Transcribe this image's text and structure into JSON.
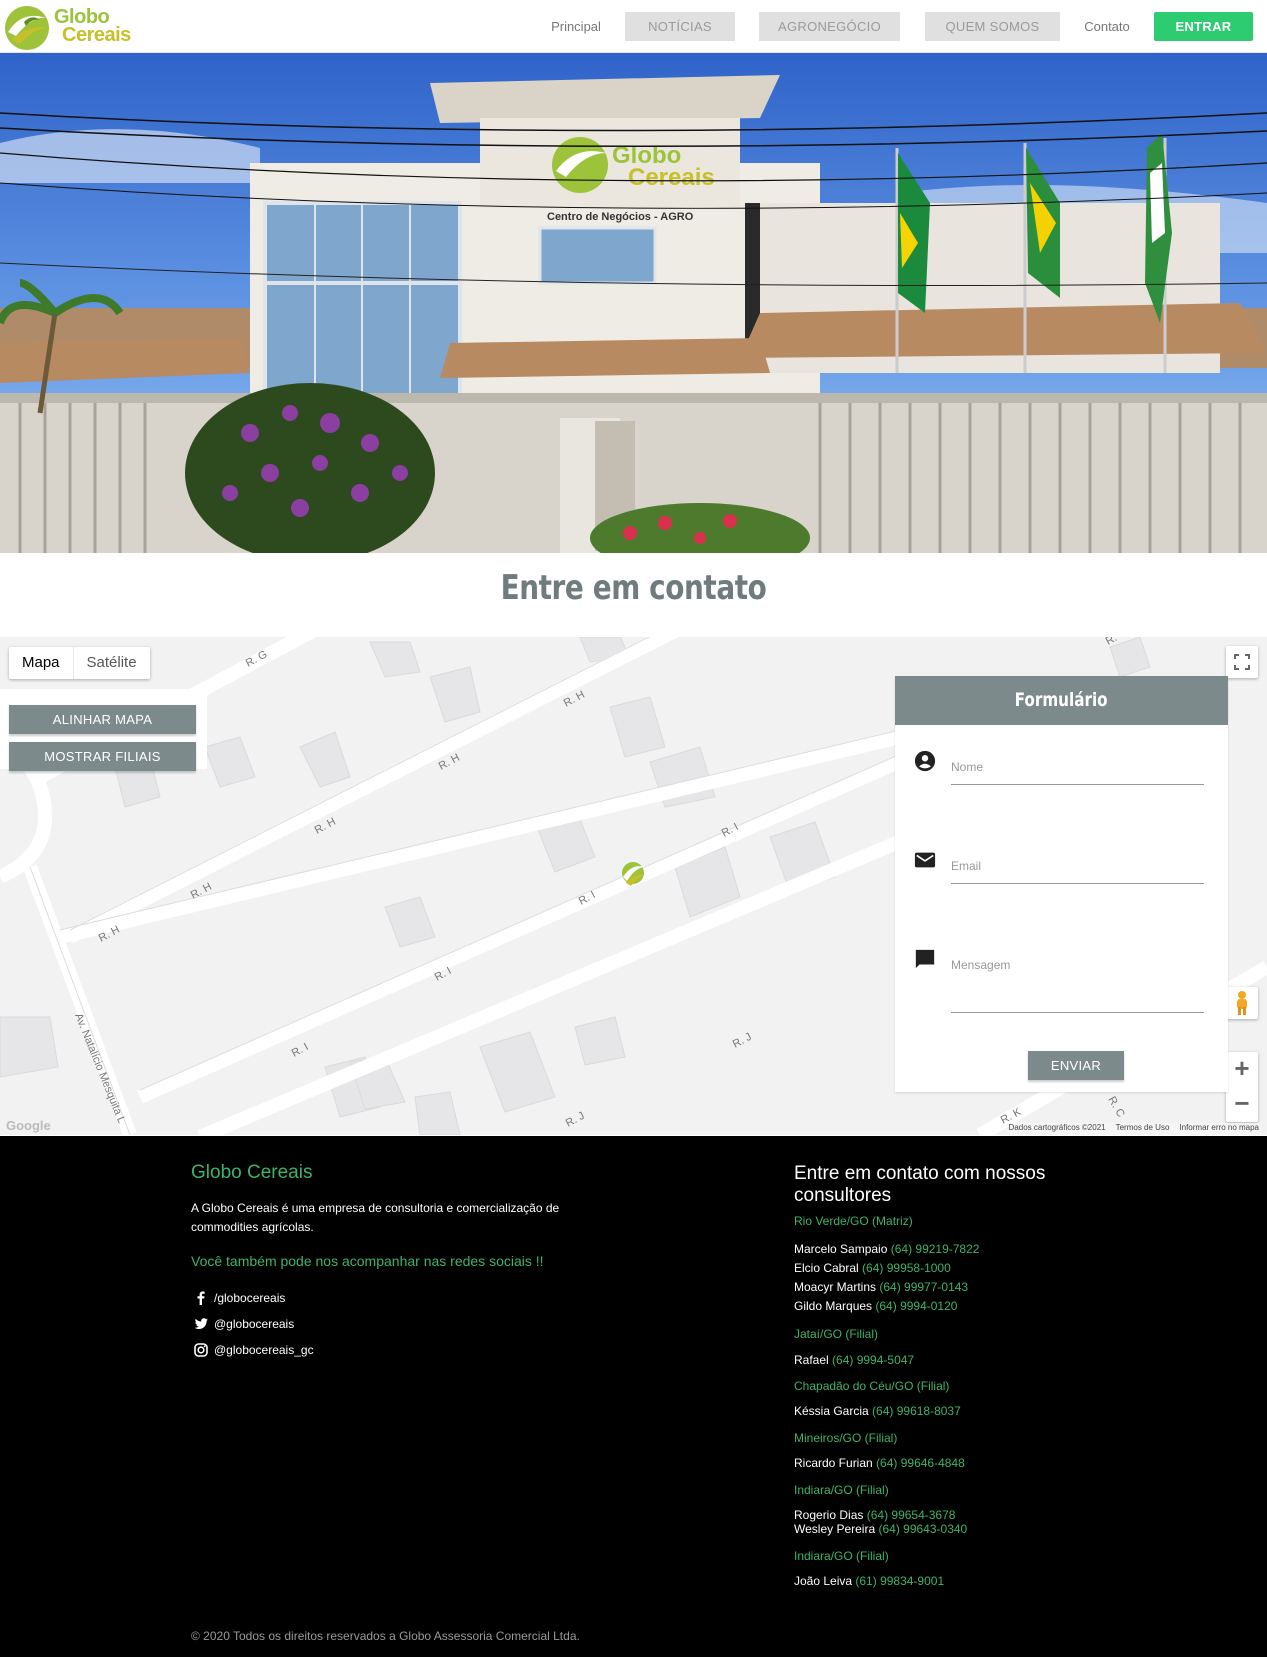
{
  "brand": {
    "name_line1": "Globo",
    "name_line2": "Cereais",
    "green": "#9cc33a",
    "yellow": "#c8c02a"
  },
  "nav": {
    "principal": "Principal",
    "noticias": "NOTÍCIAS",
    "agronegocio": "AGRONEGÓCIO",
    "quem_somos": "QUEM SOMOS",
    "contato": "Contato",
    "entrar": "ENTRAR"
  },
  "hero": {
    "sign_line1": "Globo",
    "sign_line2": "Cereais",
    "sign_subtitle": "Centro de Negócios - AGRO"
  },
  "contact": {
    "title": "Entre em contato"
  },
  "map": {
    "tabs": [
      "Mapa",
      "Satélite"
    ],
    "align_button": "ALINHAR MAPA",
    "branches_button": "MOSTRAR FILIAIS",
    "streets": [
      "R. G",
      "R. H",
      "R. H",
      "R. H",
      "R. H",
      "R. H",
      "R. I",
      "R. I",
      "R. I",
      "R. I",
      "R. J",
      "R. J",
      "R. K",
      "R. C",
      "Av. Natalício Mesquita L",
      "R."
    ],
    "zoom_in": "+",
    "zoom_out": "−",
    "google": "Google",
    "attribution": [
      "Dados cartográficos ©2021",
      "Termos de Uso",
      "Informar erro no mapa"
    ]
  },
  "form": {
    "title": "Formulário",
    "name_placeholder": "Nome",
    "email_placeholder": "Email",
    "message_placeholder": "Mensagem",
    "send": "ENVIAR"
  },
  "footer": {
    "title": "Globo Cereais",
    "description": "A Globo Cereais é uma empresa de consultoria e comercialização de commodities agrícolas.",
    "follow": "Você também pode nos acompanhar nas redes sociais !!",
    "social": [
      {
        "icon": "facebook-icon",
        "handle": "/globocereais"
      },
      {
        "icon": "twitter-icon",
        "handle": "@globocereais"
      },
      {
        "icon": "instagram-icon",
        "handle": "@globocereais_gc"
      }
    ],
    "consultants_title": "Entre em contato com nossos consultores",
    "offices": [
      {
        "city": "Rio Verde/GO (Matriz)",
        "people": [
          {
            "name": "Marcelo Sampaio",
            "phone": "(64) 99219-7822"
          },
          {
            "name": "Elcio Cabral",
            "phone": "(64) 99958-1000"
          },
          {
            "name": "Moacyr Martins",
            "phone": "(64) 99977-0143"
          },
          {
            "name": "Gildo Marques",
            "phone": "(64) 9994-0120"
          }
        ]
      },
      {
        "city": "Jataí/GO (Filial)",
        "people": [
          {
            "name": "Rafael",
            "phone": "(64) 9994-5047"
          }
        ]
      },
      {
        "city": "Chapadão do Céu/GO (Filial)",
        "people": [
          {
            "name": "Késsia Garcia",
            "phone": "(64) 99618-8037"
          }
        ]
      },
      {
        "city": "Mineiros/GO (Filial)",
        "people": [
          {
            "name": "Ricardo Furian",
            "phone": "(64) 99646-4848"
          }
        ]
      },
      {
        "city": "Indiara/GO (Filial)",
        "people": [
          {
            "name": "Rogerio Dias",
            "phone": "(64) 99654-3678"
          },
          {
            "name": "Wesley Pereira",
            "phone": "(64) 99643-0340"
          }
        ]
      },
      {
        "city": "Indiara/GO (Filial)",
        "people": [
          {
            "name": "João Leiva",
            "phone": "(61) 99834-9001"
          }
        ]
      }
    ],
    "copyright": "© 2020 Todos os direitos reservados a Globo Assessoria Comercial Ltda."
  }
}
